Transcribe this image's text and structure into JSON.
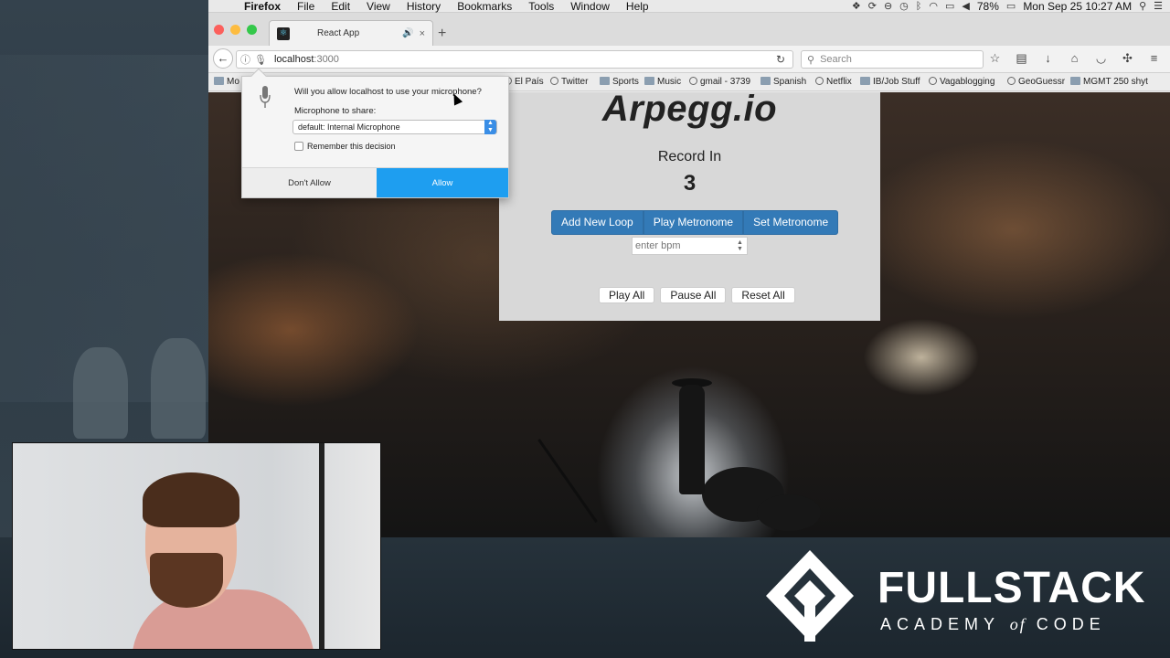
{
  "menubar": {
    "app_name": "Firefox",
    "items": [
      "File",
      "Edit",
      "View",
      "History",
      "Bookmarks",
      "Tools",
      "Window",
      "Help"
    ],
    "battery": "78%",
    "clock": "Mon Sep 25  10:27 AM"
  },
  "browser": {
    "tab_title": "React App",
    "url_host": "localhost",
    "url_port": ":3000",
    "search_placeholder": "Search",
    "bookmarks": [
      "Mo",
      "El País",
      "Twitter",
      "Sports",
      "Music",
      "gmail - 3739",
      "Spanish",
      "Netflix",
      "IB/Job Stuff",
      "Vagablogging",
      "GeoGuessr",
      "MGMT 250 shyt"
    ]
  },
  "permission": {
    "question": "Will you allow localhost to use your microphone?",
    "share_label": "Microphone to share:",
    "selected_device": "default: Internal Microphone",
    "remember_label": "Remember this decision",
    "deny_label": "Don't Allow",
    "allow_label": "Allow"
  },
  "app": {
    "title": "Arpegg.io",
    "record_label": "Record In",
    "countdown": "3",
    "buttons": [
      "Add New Loop",
      "Play Metronome",
      "Set Metronome"
    ],
    "bpm_placeholder": "enter bpm",
    "controls": [
      "Play All",
      "Pause All",
      "Reset All"
    ]
  },
  "branding": {
    "name": "FULLSTACK",
    "tagline_pre": "ACADEMY",
    "tagline_of": "of",
    "tagline_post": "CODE"
  },
  "colors": {
    "primary_button": "#337ab7",
    "allow_button": "#1e9ef0"
  }
}
